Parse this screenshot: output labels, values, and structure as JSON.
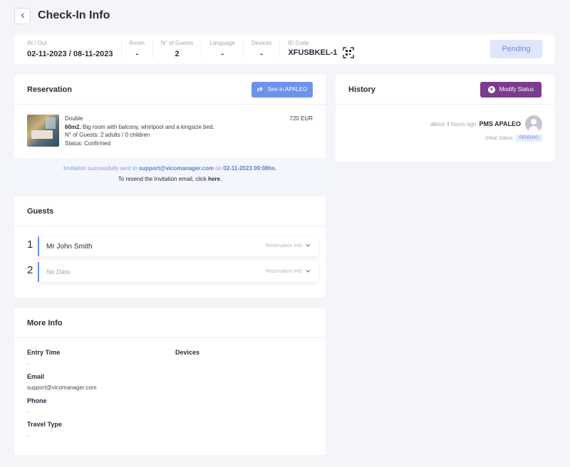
{
  "header": {
    "title": "Check-In Info"
  },
  "info_bar": {
    "in_out_label": "IN / Out",
    "in_out_value": "02-11-2023 / 08-11-2023",
    "room_label": "Room",
    "room_value": "-",
    "guests_label": "N° of Guests",
    "guests_value": "2",
    "language_label": "Language",
    "language_value": "-",
    "devices_label": "Devices",
    "devices_value": "-",
    "id_code_label": "ID Code",
    "id_code_value": "XFUSBKEL-1",
    "status_button": "Pending"
  },
  "reservation": {
    "title": "Reservation",
    "apaleo_button": "See in APALEO",
    "room_type": "Double",
    "room_size": "60m2.",
    "room_desc": " Big room with balcony, whirlpool and a kingsize bed.",
    "guests_text": "N° of Guests: 2 adults / 0 children",
    "status_text": "Status: Confirmed",
    "price": "720 EUR",
    "invite_prefix": "Invitation successfully sent to ",
    "invite_email": "support@vicomanager.com",
    "invite_mid": " on ",
    "invite_date": "02-11-2023 09:08hs.",
    "resend_prefix": "To resend the Invitation email, click ",
    "resend_link": "here",
    "resend_suffix": "."
  },
  "history": {
    "title": "History",
    "modify_button": "Modify Status",
    "entry_time": "about 4 hours ago",
    "entry_source": "PMS APALEO",
    "entry_label": "Initial Status",
    "entry_status": "PENDING"
  },
  "guests": {
    "title": "Guests",
    "rows": [
      {
        "num": "1",
        "name": "Mr John Smith",
        "info": "Reservation Info"
      },
      {
        "num": "2",
        "name": "No Data",
        "info": "Reservation Info"
      }
    ]
  },
  "more_info": {
    "title": "More Info",
    "entry_time_label": "Entry Time",
    "entry_time_value": "-",
    "devices_label": "Devices",
    "email_label": "Email",
    "email_value": "support@vicomanager.com",
    "phone_label": "Phone",
    "phone_value": "-",
    "travel_type_label": "Travel Type",
    "travel_type_value": "-"
  }
}
